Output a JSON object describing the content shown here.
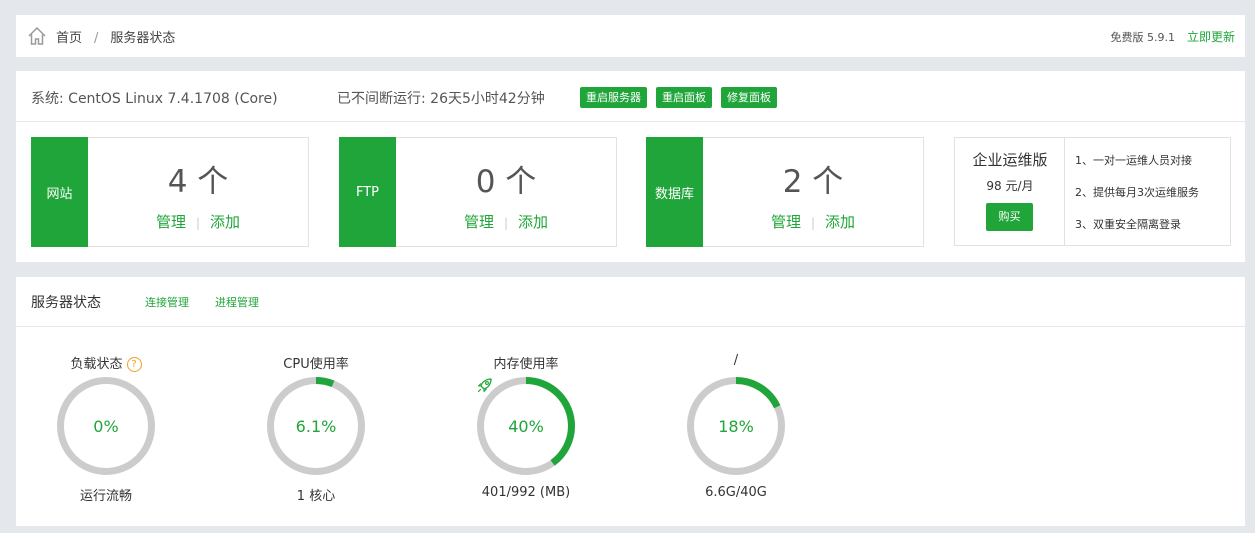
{
  "breadcrumb": {
    "home": "首页",
    "current": "服务器状态"
  },
  "version": {
    "text": "免费版 5.9.1",
    "update_label": "立即更新"
  },
  "system": {
    "os": "系统: CentOS Linux 7.4.1708 (Core)",
    "uptime": "已不间断运行: 26天5小时42分钟",
    "buttons": [
      "重启服务器",
      "重启面板",
      "修复面板"
    ]
  },
  "cards": [
    {
      "label": "网站",
      "count": "4 个",
      "manage": "管理",
      "add": "添加"
    },
    {
      "label": "FTP",
      "count": "0 个",
      "manage": "管理",
      "add": "添加"
    },
    {
      "label": "数据库",
      "count": "2 个",
      "manage": "管理",
      "add": "添加"
    }
  ],
  "enterprise": {
    "title": "企业运维版",
    "price": "98 元/月",
    "buy": "购买",
    "features": [
      "1、一对一运维人员对接",
      "2、提供每月3次运维服务",
      "3、双重安全隔离登录"
    ]
  },
  "status": {
    "title": "服务器状态",
    "links": [
      "连接管理",
      "进程管理"
    ],
    "gauges": [
      {
        "title": "负载状态",
        "value": "0%",
        "percent": 0,
        "sub": "运行流畅",
        "help": "?"
      },
      {
        "title": "CPU使用率",
        "value": "6.1%",
        "percent": 6.1,
        "sub": "1 核心"
      },
      {
        "title": "内存使用率",
        "value": "40%",
        "percent": 40,
        "sub": "401/992 (MB)"
      },
      {
        "title": "/",
        "value": "18%",
        "percent": 18,
        "sub": "6.6G/40G"
      }
    ]
  },
  "colors": {
    "accent": "#20a53a",
    "track": "#cccccc",
    "help": "#f0a020"
  },
  "icons": {
    "home": "home-icon",
    "help": "help-icon",
    "rocket": "rocket-icon"
  }
}
